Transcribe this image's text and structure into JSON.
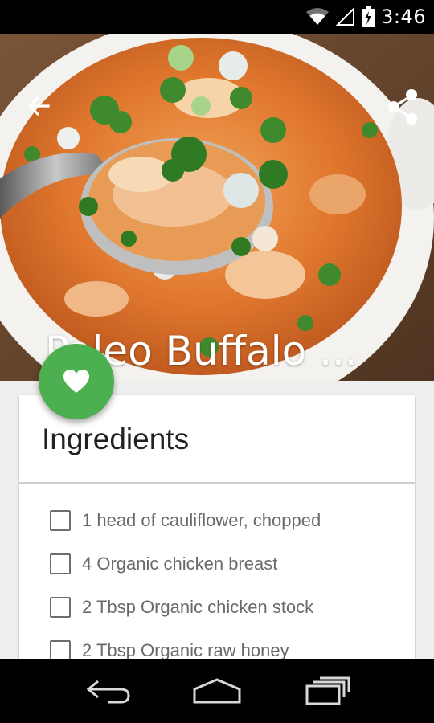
{
  "status": {
    "time": "3:46",
    "wifi_icon": "wifi-icon",
    "signal_icon": "signal-icon",
    "battery_icon": "battery-charging-icon"
  },
  "toolbar": {
    "back_icon": "arrow-back-icon",
    "share_icon": "share-icon"
  },
  "hero": {
    "title": "Paleo Buffalo ..."
  },
  "fab": {
    "icon": "heart-icon",
    "color": "#4caf50"
  },
  "ingredients": {
    "title": "Ingredients",
    "items": [
      {
        "label": "1 head of cauliflower, chopped",
        "checked": false
      },
      {
        "label": "4 Organic chicken breast",
        "checked": false
      },
      {
        "label": "2 Tbsp Organic chicken stock",
        "checked": false
      },
      {
        "label": "2 Tbsp Organic raw honey",
        "checked": false
      }
    ]
  },
  "navbar": {
    "back_icon": "nav-back-icon",
    "home_icon": "nav-home-icon",
    "recents_icon": "nav-recents-icon"
  }
}
